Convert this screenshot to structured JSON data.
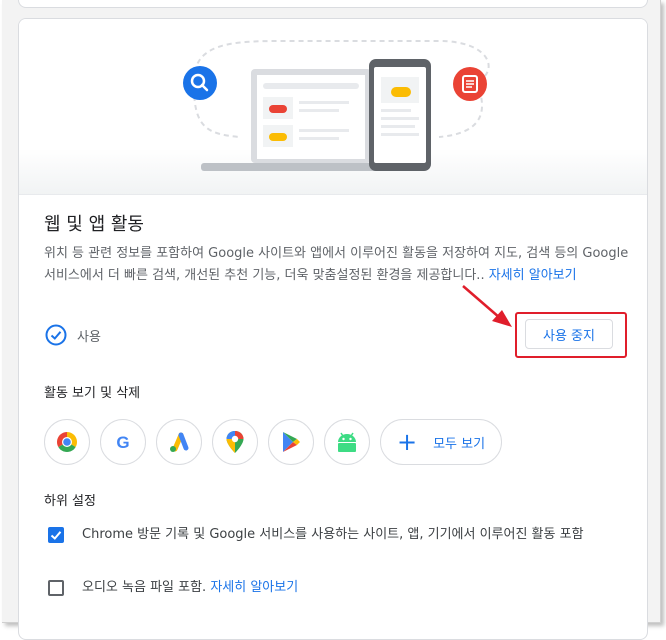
{
  "colors": {
    "accent": "#1a73e8",
    "highlight": "#e01e2b",
    "text": "#202124",
    "secondary": "#5f6368"
  },
  "section": {
    "title": "웹 및 앱 활동",
    "description": "위치 등 관련 정보를 포함하여 Google 사이트와 앱에서 이루어진 활동을 저장하여 지도, 검색 등의 Google 서비스에서 더 빠른 검색, 개선된 추천 기능, 더욱 맞춤설정된 환경을 제공합니다..",
    "learn_more": "자세히 알아보기",
    "status_label": "사용",
    "stop_button": "사용 중지"
  },
  "activity": {
    "title": "활동 보기 및 삭제",
    "apps": [
      "chrome-icon",
      "google-icon",
      "google-ads-icon",
      "google-maps-icon",
      "google-play-icon",
      "android-icon"
    ],
    "view_all": "모두 보기"
  },
  "sub_settings": {
    "title": "하위 설정",
    "options": [
      {
        "label": "Chrome 방문 기록 및 Google 서비스를 사용하는 사이트, 앱, 기기에서 이루어진 활동 포함",
        "checked": true
      },
      {
        "label": "오디오 녹음 파일 포함.",
        "checked": false,
        "link": "자세히 알아보기"
      }
    ]
  }
}
